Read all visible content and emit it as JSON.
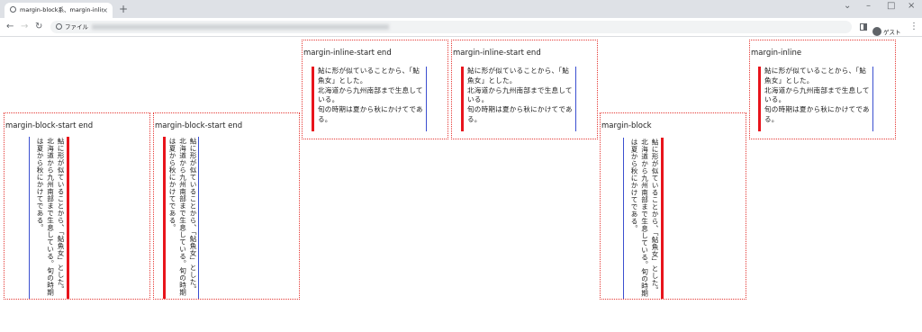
{
  "browser": {
    "tab_title": "margin-block系、margin-inline系",
    "tab_close": "×",
    "new_tab": "+",
    "window_controls": {
      "minimize": "–",
      "maximize": "□",
      "close": "×",
      "tab_search": "⌄"
    },
    "nav": {
      "back": "←",
      "forward": "→",
      "reload": "↻"
    },
    "address_prefix": "ファイル",
    "profile_name": "ゲスト",
    "menu": "⋮"
  },
  "paragraph": {
    "sentences": [
      "鮎に形が似ていることから、「鮎魚女」とした。",
      "北海道から九州南部まで生息している。",
      "旬の時期は夏から秋にかけてである。"
    ]
  },
  "boxes": [
    {
      "caption": "margin-block-start end",
      "mode": "vertical-rl"
    },
    {
      "caption": "margin-block-start end",
      "mode": "vertical-lr"
    },
    {
      "caption": "margin-inline-start end",
      "mode": "horizontal"
    },
    {
      "caption": "margin-inline-start end",
      "mode": "horizontal"
    },
    {
      "caption": "margin-block",
      "mode": "vertical-rl"
    },
    {
      "caption": "margin-inline",
      "mode": "horizontal"
    }
  ],
  "colors": {
    "box_border": "#e53935",
    "start_border": "#e8141c",
    "end_border": "#3b4fd0"
  }
}
